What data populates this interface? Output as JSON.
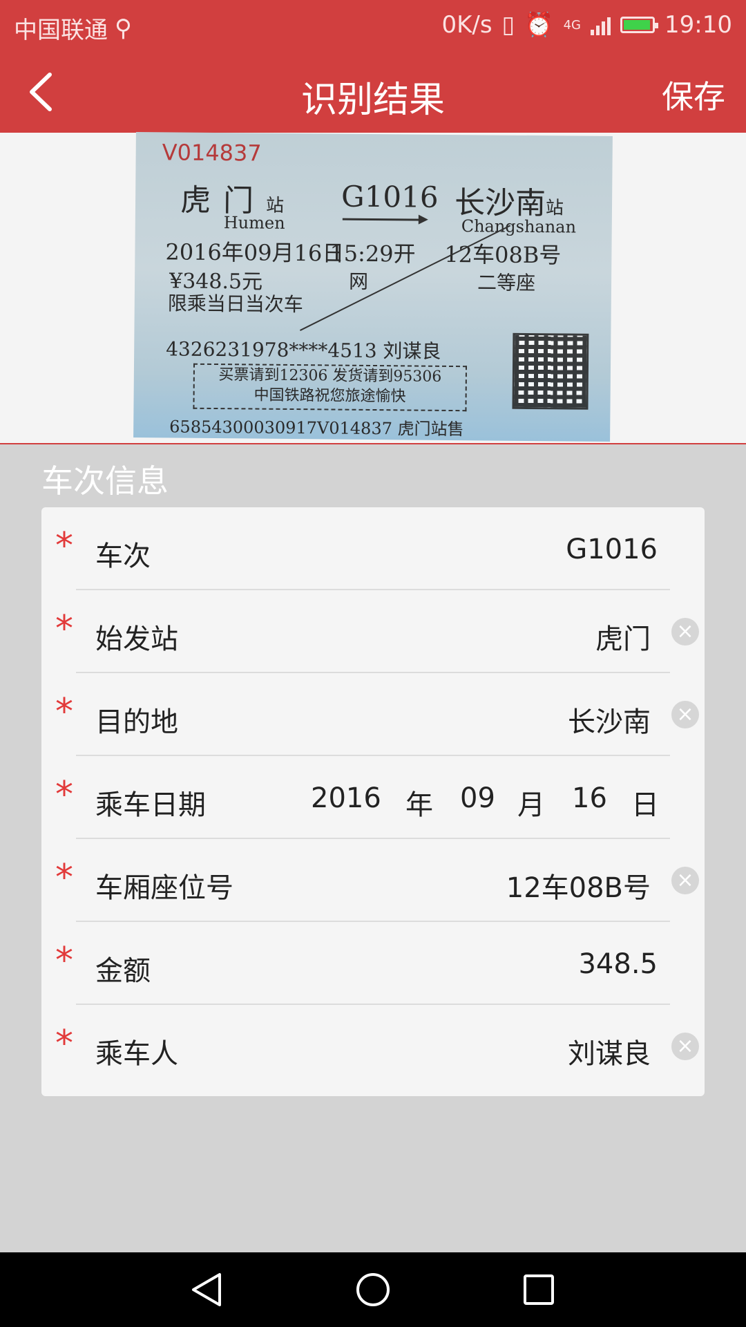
{
  "status_bar": {
    "carrier": "中国联通",
    "usb_icon": "usb-icon",
    "net_speed": "0K/s",
    "network": "4G",
    "time": "19:10"
  },
  "app_bar": {
    "title": "识别结果",
    "save_label": "保存",
    "back_icon": "chevron-left-icon"
  },
  "ticket_image": {
    "serial": "V014837",
    "from_station": "虎门",
    "station_suffix": "站",
    "train_no": "G1016",
    "to_station": "长沙南",
    "from_pinyin": "Humen",
    "to_pinyin": "Changshanan",
    "date": "2016年09月16日",
    "time": "15:29开",
    "seat": "12车08B号",
    "price": "¥348.5元",
    "channel": "网",
    "seat_class": "二等座",
    "limit_note": "限乘当日当次车",
    "id_and_name": "4326231978****4513 刘谋良",
    "notice_line1": "买票请到12306 发货请到95306",
    "notice_line2": "中国铁路祝您旅途愉快",
    "bottom_code": "65854300030917V014837 虎门站售"
  },
  "section": {
    "title": "车次信息"
  },
  "form": {
    "required_mark": "*",
    "fields": [
      {
        "label": "车次",
        "value": "G1016",
        "clearable": false
      },
      {
        "label": "始发站",
        "value": "虎门",
        "clearable": true
      },
      {
        "label": "目的地",
        "value": "长沙南",
        "clearable": true
      },
      {
        "label": "乘车日期",
        "year": "2016",
        "year_unit": "年",
        "month": "09",
        "month_unit": "月",
        "day": "16",
        "day_unit": "日"
      },
      {
        "label": "车厢座位号",
        "value": "12车08B号",
        "clearable": true
      },
      {
        "label": "金额",
        "value": "348.5",
        "clearable": false
      },
      {
        "label": "乘车人",
        "value": "刘谋良",
        "clearable": true
      }
    ],
    "clear_icon_glyph": "×"
  },
  "colors": {
    "primary": "#d13f3f",
    "required": "#e23a3a",
    "background": "#d3d3d3",
    "card": "#f5f5f5"
  }
}
